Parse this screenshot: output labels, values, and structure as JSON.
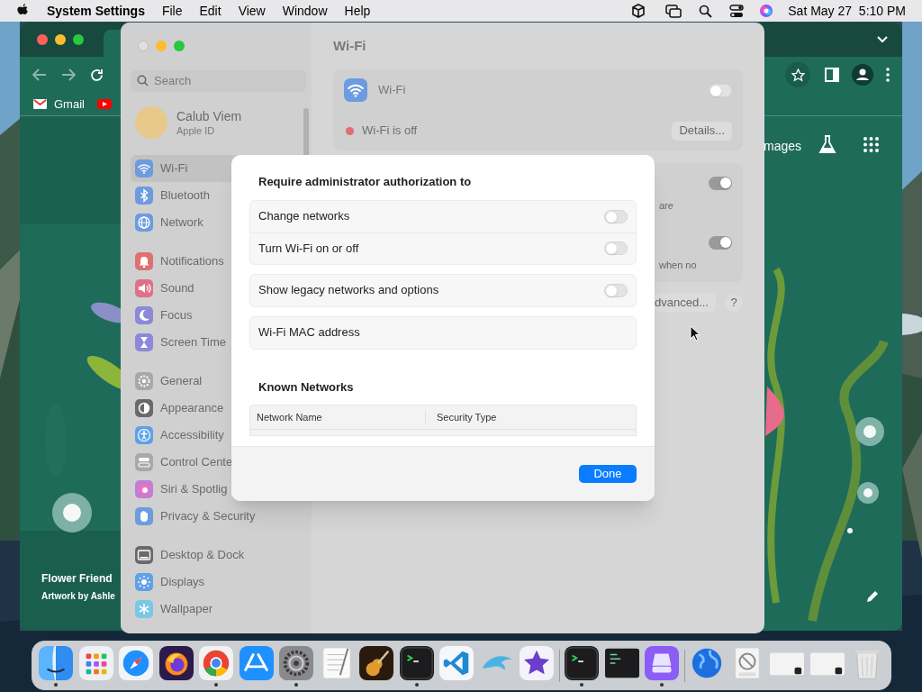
{
  "menu_bar": {
    "app_name": "System Settings",
    "menus": [
      "File",
      "Edit",
      "View",
      "Window",
      "Help"
    ],
    "clock": "Sat May 27  5:10 PM"
  },
  "browser": {
    "bookmarks": [
      {
        "kind": "mail",
        "label": "Gmail"
      },
      {
        "kind": "video"
      }
    ],
    "page": {
      "link": "mages",
      "doodle_title": "Flower Friend",
      "doodle_credit": "Artwork by Ashle"
    }
  },
  "settings": {
    "search": {
      "placeholder": "Search"
    },
    "account": {
      "name": "Calub Viem",
      "subtitle": "Apple ID"
    },
    "sidebar": {
      "groups": [
        [
          {
            "label": "Wi-Fi",
            "kind": "wifi",
            "color": "#6c9be0",
            "selected": true
          },
          {
            "label": "Bluetooth",
            "kind": "bluetooth",
            "color": "#6c9be0",
            "selected": false
          },
          {
            "label": "Network",
            "kind": "globe",
            "color": "#6c9be0",
            "selected": false
          }
        ],
        [
          {
            "label": "Notifications",
            "kind": "bell",
            "color": "#e07070",
            "selected": false
          },
          {
            "label": "Sound",
            "kind": "speaker",
            "color": "#e0708a",
            "selected": false
          },
          {
            "label": "Focus",
            "kind": "moon",
            "color": "#8b89d8",
            "selected": false
          },
          {
            "label": "Screen Time",
            "kind": "hourglass",
            "color": "#8b89d8",
            "selected": false
          }
        ],
        [
          {
            "label": "General",
            "kind": "gear",
            "color": "#a8a8ab",
            "selected": false
          },
          {
            "label": "Appearance",
            "kind": "appearance",
            "color": "#6a6a6c",
            "selected": false
          },
          {
            "label": "Accessibility",
            "kind": "person",
            "color": "#5fa0e8",
            "selected": false
          },
          {
            "label": "Control Cente",
            "kind": "switches",
            "color": "#a8a8ab",
            "selected": false
          },
          {
            "label": "Siri & Spotlig",
            "kind": "orb",
            "color": "#c27fd2",
            "selected": false
          },
          {
            "label": "Privacy & Security",
            "kind": "hand",
            "color": "#6c9be0",
            "selected": false
          }
        ],
        [
          {
            "label": "Desktop & Dock",
            "kind": "dock",
            "color": "#6a6a6c",
            "selected": false
          },
          {
            "label": "Displays",
            "kind": "sun",
            "color": "#5fa0e8",
            "selected": false
          },
          {
            "label": "Wallpaper",
            "kind": "snowflake",
            "color": "#78c8e6",
            "selected": false
          }
        ]
      ]
    },
    "title": "Wi-Fi",
    "wifi_row": {
      "label": "Wi-Fi",
      "on": false
    },
    "status": "Wi-Fi is off",
    "details_button": "Details...",
    "partial_rows": [
      {
        "text": "are",
        "on": true
      },
      {
        "text": "when no",
        "on": true
      }
    ],
    "advanced_button": "dvanced...",
    "help_button": "?"
  },
  "dialog": {
    "title": "Require administrator authorization to",
    "groups": [
      [
        {
          "label": "Change networks",
          "kind": "toggle",
          "on": false
        },
        {
          "label": "Turn Wi-Fi on or off",
          "kind": "toggle",
          "on": false
        }
      ],
      [
        {
          "label": "Show legacy networks and options",
          "kind": "toggle",
          "on": false
        }
      ],
      [
        {
          "label": "Wi-Fi MAC address",
          "kind": "info"
        }
      ]
    ],
    "known_networks": {
      "title": "Known Networks",
      "columns": [
        "Network Name",
        "Security Type"
      ]
    },
    "done_button": "Done"
  },
  "dock": {
    "items": [
      {
        "kind": "finder",
        "running": true
      },
      {
        "kind": "launchpad",
        "running": false
      },
      {
        "kind": "compass",
        "running": false
      },
      {
        "kind": "flame",
        "running": false
      },
      {
        "kind": "chrome",
        "running": true
      },
      {
        "kind": "appstore",
        "running": false
      },
      {
        "kind": "gear",
        "running": true
      },
      {
        "kind": "notepad",
        "running": false
      },
      {
        "kind": "guitar",
        "running": false
      },
      {
        "kind": "terminal",
        "running": true
      },
      {
        "kind": "ribbon",
        "running": false
      },
      {
        "kind": "dolphin",
        "running": false
      },
      {
        "kind": "star",
        "running": false
      },
      {
        "kind": "separator"
      },
      {
        "kind": "terminal",
        "running": true
      },
      {
        "kind": "console",
        "running": false
      },
      {
        "kind": "drive",
        "running": true
      },
      {
        "kind": "separator"
      },
      {
        "kind": "globe",
        "running": false
      },
      {
        "kind": "document",
        "running": false
      },
      {
        "kind": "thumbnail",
        "running": false
      },
      {
        "kind": "thumbnail",
        "running": false
      },
      {
        "kind": "trash",
        "running": false
      }
    ]
  }
}
